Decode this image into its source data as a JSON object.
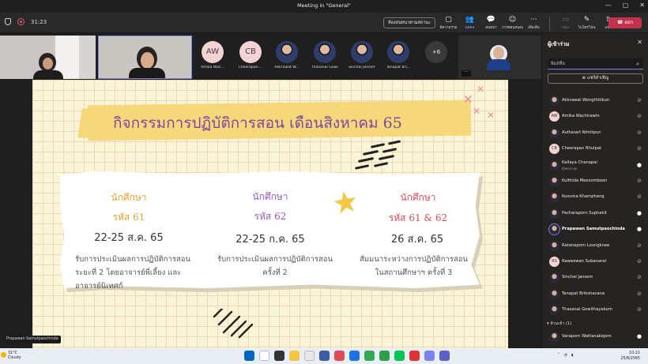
{
  "window": {
    "title": "Meeting in \"General\"",
    "controls": [
      "—",
      "▢",
      "✕"
    ]
  },
  "toolbar": {
    "timer": "31:23",
    "meeting_room_button": "ห้องสนทนาตามสถานะ",
    "actions": [
      {
        "icon": "screen-share-icon",
        "glyph": "▢",
        "label": "มีความร่วม"
      },
      {
        "icon": "people-icon",
        "glyph": "👥",
        "label": "บุคคล"
      },
      {
        "icon": "chat-icon",
        "glyph": "💬",
        "label": "สนทนา"
      },
      {
        "icon": "reactions-icon",
        "glyph": "☺",
        "label": "การตอบสนอง"
      },
      {
        "icon": "more-icon",
        "glyph": "···",
        "label": "เพิ่มเติม"
      }
    ],
    "camera_label": "กล้อง",
    "mic_label": "ไมโครโฟน",
    "share_label": "แชร์",
    "leave_label": "ออก"
  },
  "strip": {
    "participants": [
      {
        "initials": "AW",
        "name": "Amika Wac...",
        "color": "#f3d3d3"
      },
      {
        "initials": "CB",
        "name": "Cheerapan ...",
        "color": "#f3d3d3"
      },
      {
        "initials": "",
        "name": "Akkrawat W...",
        "color": ""
      },
      {
        "initials": "",
        "name": "Thasanai Gowit...",
        "color": ""
      },
      {
        "initials": "",
        "name": "Sinchai Jansem",
        "color": ""
      },
      {
        "initials": "",
        "name": "Tanapat Bri...",
        "color": ""
      }
    ],
    "more_count": "+6",
    "ellipsis": "···"
  },
  "slide": {
    "title": "กิจกรรมการปฏิบัติการสอน  เดือนสิงหาคม  65",
    "columns": [
      {
        "label1": "นักศึกษา",
        "label2": "รหัส  61",
        "date": "22-25  ส.ค.  65",
        "desc": [
          "รับการประเมินผลการปฏิบัติการสอน",
          "ระยะที่  2  โดยอาจารย์พี่เลี้ยง  และ",
          "อาจารย์นิเทศก์"
        ],
        "color": "#e2a52e"
      },
      {
        "label1": "นักศึกษา",
        "label2": "รหัส  62",
        "date": "22-25  ก.ค.  65",
        "desc": [
          "รับการประเมินผลการปฏิบัติการสอน",
          "ครั้งที่  2"
        ],
        "color": "#9b59c6"
      },
      {
        "label1": "นักศึกษา",
        "label2": "รหัส  61  &  62",
        "date": "26  ส.ค.  65",
        "desc": [
          "สัมมนาระหว่างการปฏิบัติการสอน",
          "ในสถานศึกษาฯ  ครั้งที่  3"
        ],
        "color": "#e04b56"
      }
    ]
  },
  "presenter_badge": "Prapawan Samutpaochinda",
  "panel": {
    "title": "ผู้เข้าร่วม",
    "search_placeholder": "พิมพ์ชื่อ",
    "share_invite": "แชร์คำเชิญ",
    "people": [
      {
        "name": "Akkrawat Wongthitikun",
        "initials": "",
        "mic": "muted"
      },
      {
        "name": "Amika Wachirawin",
        "initials": "AW",
        "mic": "muted"
      },
      {
        "name": "Auttasart Nimitpun",
        "initials": "",
        "mic": "muted"
      },
      {
        "name": "Cheerapan Bhulpat",
        "initials": "CB",
        "mic": "muted"
      },
      {
        "name": "Kallaya Chanapai",
        "sub": "ผู้จัดประชุม",
        "initials": "",
        "mic": "on"
      },
      {
        "name": "Kulthida Meesomboon",
        "initials": "",
        "mic": "muted"
      },
      {
        "name": "Kusuma Khamphang",
        "initials": "",
        "mic": "muted"
      },
      {
        "name": "Pacharaporn Suphakit",
        "initials": "",
        "mic": "on"
      },
      {
        "name": "Prapawan Samutpaochinda",
        "initials": "",
        "mic": "on",
        "active": true
      },
      {
        "name": "Ratanaporn Loungkraw",
        "initials": "",
        "mic": "muted"
      },
      {
        "name": "Raweewan Subanarat",
        "initials": "RS",
        "mic": "muted"
      },
      {
        "name": "Sinchai Jansem",
        "initials": "",
        "mic": "muted"
      },
      {
        "name": "Tanapat Brikshavana",
        "initials": "",
        "mic": "muted"
      },
      {
        "name": "Thasanai Gowithayakom",
        "initials": "",
        "mic": "muted"
      }
    ],
    "group_label": "ห้ามเข้า (1)",
    "group_people": [
      {
        "name": "Varaporn Wattanakejorn",
        "initials": "",
        "mic": "on"
      }
    ]
  },
  "taskbar": {
    "temperature": "31°C",
    "weather": "Cloudy",
    "time": "10:21",
    "date": "25/8/2565",
    "app_colors": [
      "#0067c0",
      "#ffffff",
      "#333333",
      "#f4c542",
      "#e8e8e8",
      "#3b5ba5",
      "#e04b56",
      "#1a73e8",
      "#34a853",
      "#2f9e44",
      "#06c755",
      "#d33",
      "#7b83eb",
      "#5b5fc7"
    ]
  },
  "colors": {
    "accent": "#7b83eb",
    "leave": "#c4314b",
    "slide_bg": "#fbf5d8",
    "banner": "#f6d77a",
    "title_text": "#7a4aa0"
  }
}
